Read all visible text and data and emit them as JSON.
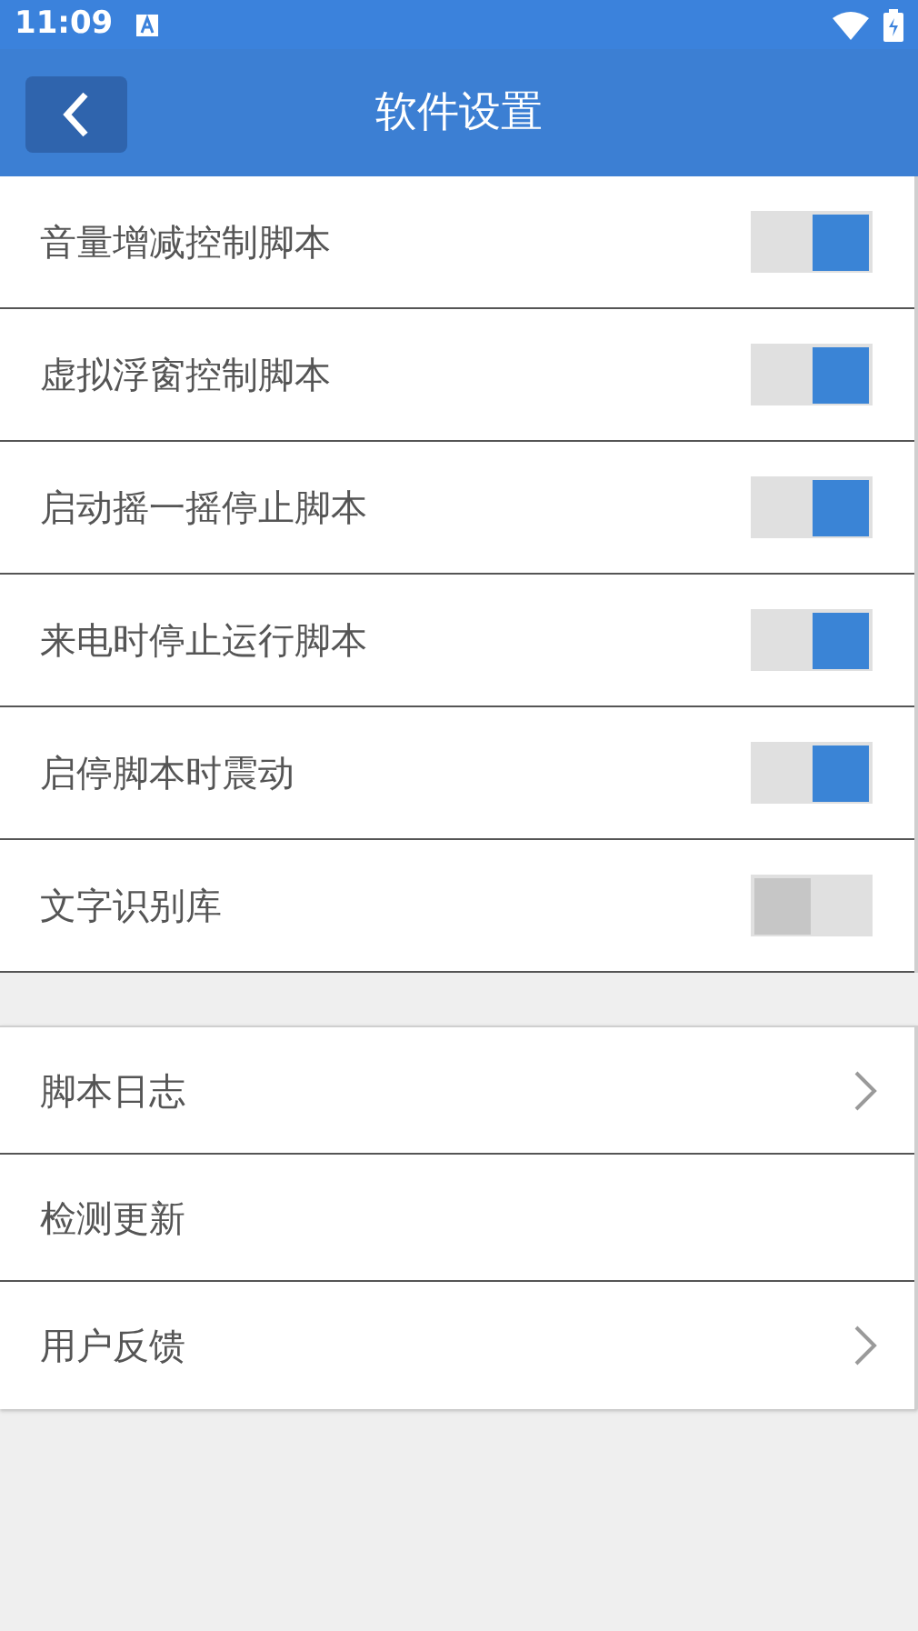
{
  "status_bar": {
    "time": "11:09"
  },
  "header": {
    "title": "软件设置"
  },
  "switches": [
    {
      "label": "音量增减控制脚本",
      "on": true
    },
    {
      "label": "虚拟浮窗控制脚本",
      "on": true
    },
    {
      "label": "启动摇一摇停止脚本",
      "on": true
    },
    {
      "label": "来电时停止运行脚本",
      "on": true
    },
    {
      "label": "启停脚本时震动",
      "on": true
    },
    {
      "label": "文字识别库",
      "on": false
    }
  ],
  "links": [
    {
      "label": "脚本日志",
      "kind": "chevron"
    },
    {
      "label": "检测更新",
      "kind": "plain"
    },
    {
      "label": "用户反馈",
      "kind": "chevron"
    }
  ]
}
